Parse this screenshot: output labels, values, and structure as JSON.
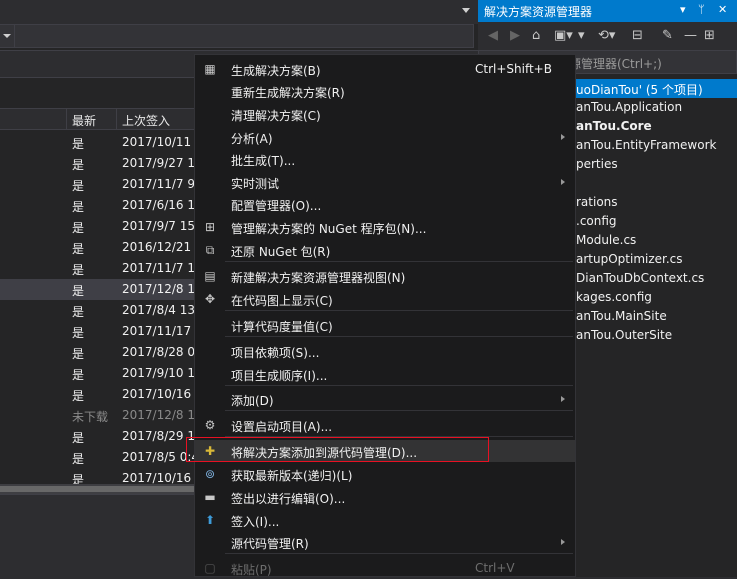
{
  "left_pane": {
    "columns": [
      "最新",
      "上次签入"
    ],
    "rows": [
      {
        "latest": "是",
        "checkin": "2017/10/11"
      },
      {
        "latest": "是",
        "checkin": "2017/9/27 1("
      },
      {
        "latest": "是",
        "checkin": "2017/11/7 9"
      },
      {
        "latest": "是",
        "checkin": "2017/6/16 1"
      },
      {
        "latest": "是",
        "checkin": "2017/9/7 15"
      },
      {
        "latest": "是",
        "checkin": "2016/12/21"
      },
      {
        "latest": "是",
        "checkin": "2017/11/7 1("
      },
      {
        "latest": "是",
        "checkin": "2017/12/8 1"
      },
      {
        "latest": "是",
        "checkin": "2017/8/4 13"
      },
      {
        "latest": "是",
        "checkin": "2017/11/17"
      },
      {
        "latest": "是",
        "checkin": "2017/8/28 0"
      },
      {
        "latest": "是",
        "checkin": "2017/9/10 1"
      },
      {
        "latest": "是",
        "checkin": "2017/10/16"
      },
      {
        "latest": "未下载",
        "checkin": "2017/12/8 1("
      },
      {
        "latest": "是",
        "checkin": "2017/8/29 1"
      },
      {
        "latest": "是",
        "checkin": "2017/8/5 0:4"
      },
      {
        "latest": "是",
        "checkin": "2017/10/16"
      }
    ]
  },
  "solution_explorer": {
    "title": "解决方案资源管理器",
    "title_controls": [
      "▾",
      "ᛘ",
      "✕"
    ],
    "search_placeholder": "源管理器(Ctrl+;)",
    "tree": [
      "uoDianTou' (5 个项目)",
      "anTou.Application",
      "anTou.Core",
      "anTou.EntityFramework",
      "perties",
      "rations",
      ".config",
      "Module.cs",
      "artupOptimizer.cs",
      "DianTouDbContext.cs",
      "kages.config",
      "anTou.MainSite",
      "anTou.OuterSite"
    ]
  },
  "context_menu": {
    "items": [
      {
        "label": "生成解决方案(B)",
        "shortcut": "Ctrl+Shift+B",
        "icon": "build-icon"
      },
      {
        "label": "重新生成解决方案(R)"
      },
      {
        "label": "清理解决方案(C)"
      },
      {
        "label": "分析(A)",
        "submenu": true
      },
      {
        "label": "批生成(T)..."
      },
      {
        "label": "实时测试",
        "submenu": true
      },
      {
        "label": "配置管理器(O)..."
      },
      {
        "label": "管理解决方案的 NuGet 程序包(N)...",
        "icon": "nuget-icon"
      },
      {
        "label": "还原 NuGet 包(R)",
        "icon": "restore-icon"
      },
      {
        "label": "新建解决方案资源管理器视图(N)",
        "icon": "new-view-icon"
      },
      {
        "label": "在代码图上显示(C)",
        "icon": "code-map-icon"
      },
      {
        "label": "计算代码度量值(C)"
      },
      {
        "label": "项目依赖项(S)..."
      },
      {
        "label": "项目生成顺序(I)..."
      },
      {
        "label": "添加(D)",
        "submenu": true
      },
      {
        "label": "设置启动项目(A)...",
        "icon": "gear-icon"
      },
      {
        "label": "将解决方案添加到源代码管理(D)...",
        "icon": "add-source-control-icon"
      },
      {
        "label": "获取最新版本(递归)(L)",
        "icon": "get-latest-icon"
      },
      {
        "label": "签出以进行编辑(O)...",
        "icon": "checkout-icon"
      },
      {
        "label": "签入(I)...",
        "icon": "checkin-icon"
      },
      {
        "label": "源代码管理(R)",
        "submenu": true
      },
      {
        "label": "粘贴(P)",
        "shortcut": "Ctrl+V",
        "icon": "paste-icon",
        "disabled": true
      }
    ]
  },
  "colors": {
    "accent": "#007acc",
    "highlight_box": "#e81123"
  }
}
